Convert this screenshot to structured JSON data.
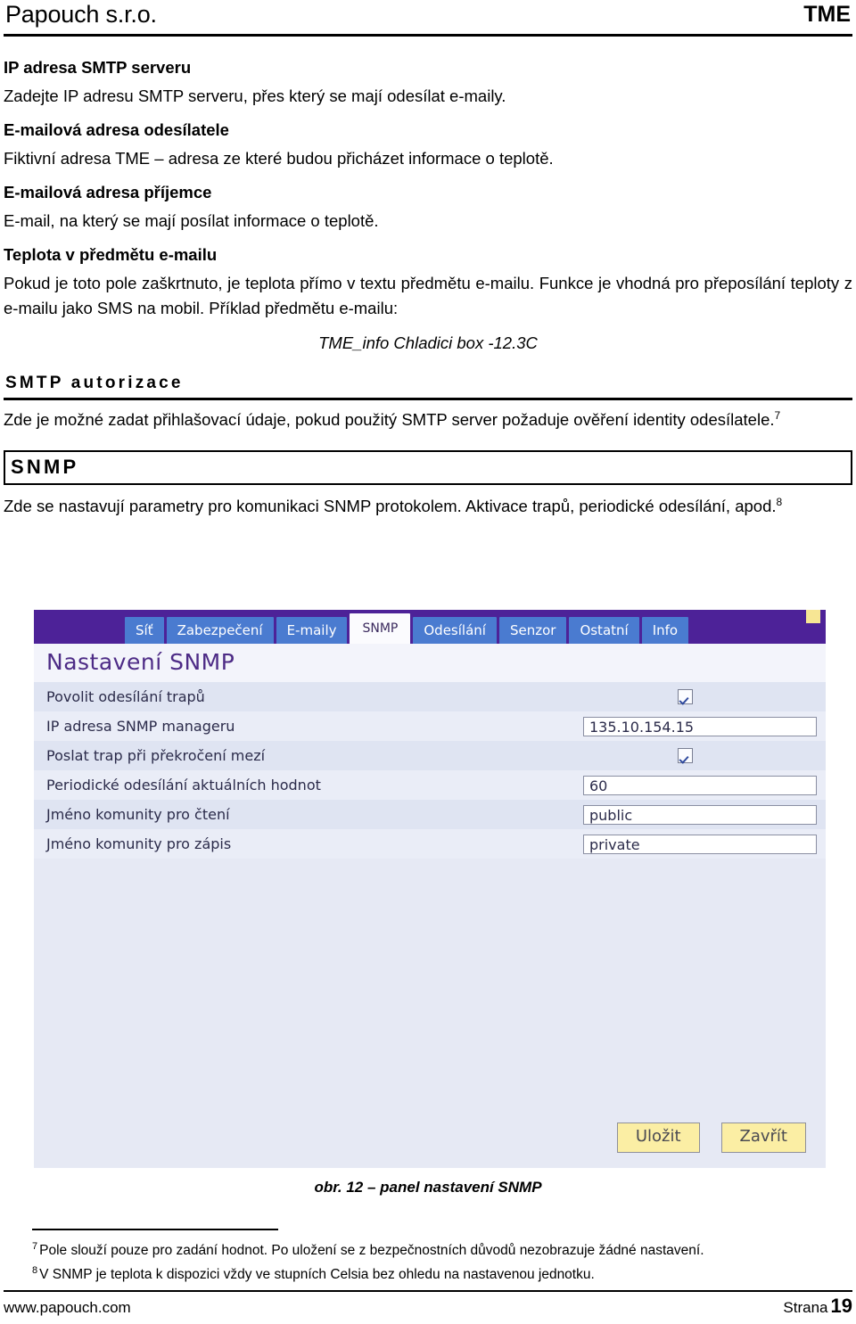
{
  "header": {
    "brand": "Papouch s.r.o.",
    "product": "TME"
  },
  "sections": [
    {
      "heading": "IP adresa SMTP serveru",
      "text": "Zadejte IP adresu SMTP serveru, přes který se mají odesílat e-maily."
    },
    {
      "heading": "E-mailová adresa odesílatele",
      "text": "Fiktivní adresa TME – adresa ze které budou přicházet informace o teplotě."
    },
    {
      "heading": "E-mailová adresa příjemce",
      "text": "E-mail, na který se mají posílat informace o teplotě."
    },
    {
      "heading": "Teplota v předmětu e-mailu",
      "text": "Pokud je toto pole zaškrtnuto, je teplota přímo v textu předmětu e-mailu. Funkce je vhodná pro přeposílání teploty z e-mailu jako SMS na mobil. Příklad předmětu e-mailu:"
    }
  ],
  "example_subject": "TME_info Chladici box -12.3C",
  "smtp_auth": {
    "heading": "SMTP autorizace",
    "text": "Zde je možné zadat přihlašovací údaje, pokud použitý SMTP server požaduje ověření identity odesílatele.",
    "footnote_marker": "7"
  },
  "snmp": {
    "heading": "SNMP",
    "text": "Zde se nastavují parametry pro komunikaci SNMP protokolem. Aktivace trapů, periodické odesílání, apod.",
    "footnote_marker": "8"
  },
  "screenshot": {
    "tabs": [
      {
        "label": "Síť",
        "active": false
      },
      {
        "label": "Zabezpečení",
        "active": false
      },
      {
        "label": "E-maily",
        "active": false
      },
      {
        "label": "SNMP",
        "active": true
      },
      {
        "label": "Odesílání",
        "active": false
      },
      {
        "label": "Senzor",
        "active": false
      },
      {
        "label": "Ostatní",
        "active": false
      },
      {
        "label": "Info",
        "active": false
      }
    ],
    "panel_title": "Nastavení SNMP",
    "rows": [
      {
        "label": "Povolit odesílání trapů",
        "type": "checkbox",
        "value": "checked"
      },
      {
        "label": "IP adresa SNMP manageru",
        "type": "text",
        "value": "135.10.154.15"
      },
      {
        "label": "Poslat trap při překročení mezí",
        "type": "checkbox",
        "value": "checked"
      },
      {
        "label": "Periodické odesílání aktuálních hodnot",
        "type": "text",
        "value": "60"
      },
      {
        "label": "Jméno komunity pro čtení",
        "type": "text",
        "value": "public"
      },
      {
        "label": "Jméno komunity pro zápis",
        "type": "text",
        "value": "private"
      }
    ],
    "buttons": {
      "save": "Uložit",
      "close": "Zavřít"
    },
    "colors": {
      "tabbar_bg": "#4d2298",
      "tab_bg": "#4a7bd0",
      "active_tab_bg": "#fbfbfe",
      "panel_bg": "#e6e9f4",
      "title_color": "#4d2b86",
      "button_bg": "#fbeea4",
      "corner_accent": "#f7e694"
    }
  },
  "figure_caption": "obr. 12 – panel nastavení SNMP",
  "footnotes": [
    {
      "marker": "7",
      "text": "Pole slouží pouze pro zadání hodnot. Po uložení se z bezpečnostních důvodů nezobrazuje žádné nastavení."
    },
    {
      "marker": "8",
      "text": "V SNMP je teplota k dispozici vždy ve stupních Celsia bez ohledu na nastavenou jednotku."
    }
  ],
  "footer": {
    "website": "www.papouch.com",
    "page_label": "Strana",
    "page_number": "19"
  }
}
